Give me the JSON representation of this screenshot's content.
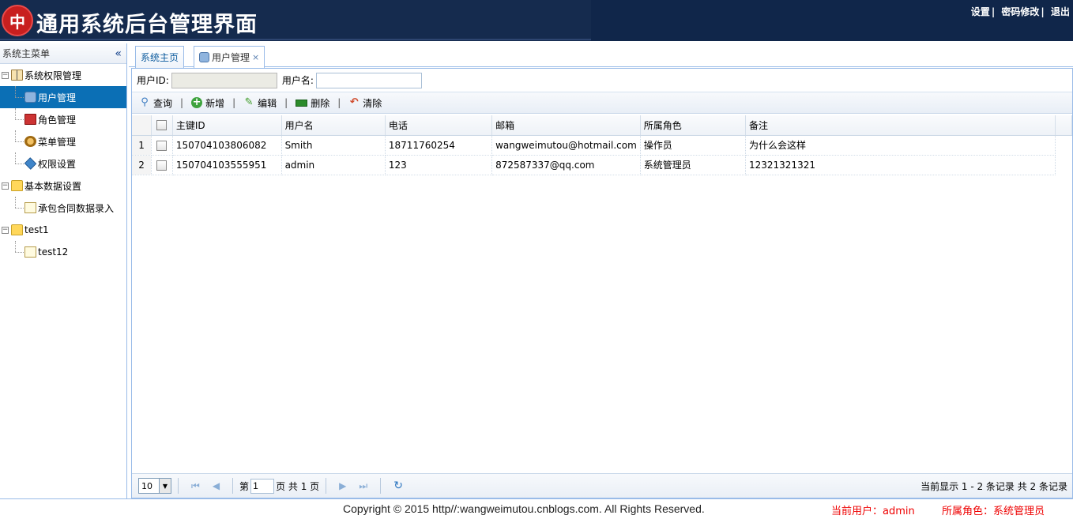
{
  "header": {
    "logo_text": "中",
    "title": "通用系统后台管理界面",
    "links": [
      "设置",
      "密码修改",
      "退出"
    ],
    "separator": "|"
  },
  "sidebar": {
    "title": "系统主菜单",
    "collapse_icon": "double-chevron-left-icon",
    "tree": [
      {
        "label": "系统权限管理",
        "level": 1,
        "icon": "book-icon",
        "expanded": true
      },
      {
        "label": "用户管理",
        "level": 2,
        "icon": "user-icon",
        "selected": true
      },
      {
        "label": "角色管理",
        "level": 2,
        "icon": "role-icon"
      },
      {
        "label": "菜单管理",
        "level": 2,
        "icon": "menu-icon"
      },
      {
        "label": "权限设置",
        "level": 2,
        "icon": "permission-icon"
      },
      {
        "label": "基本数据设置",
        "level": 1,
        "icon": "folder-icon",
        "expanded": true
      },
      {
        "label": "承包合同数据录入",
        "level": 2,
        "icon": "document-icon"
      },
      {
        "label": "test1",
        "level": 1,
        "icon": "folder-icon",
        "expanded": true
      },
      {
        "label": "test12",
        "level": 2,
        "icon": "document-icon"
      }
    ]
  },
  "tabs": [
    {
      "label": "系统主页",
      "active": false
    },
    {
      "label": "用户管理",
      "active": true,
      "close": "×"
    }
  ],
  "search": {
    "user_id_label": "用户ID:",
    "user_id_value": "",
    "username_label": "用户名:",
    "username_value": ""
  },
  "toolbar": {
    "query": "查询",
    "add": "新增",
    "edit": "编辑",
    "delete": "删除",
    "clear": "清除",
    "separator": "|"
  },
  "grid": {
    "columns": [
      "主键ID",
      "用户名",
      "电话",
      "邮箱",
      "所属角色",
      "备注"
    ],
    "rows": [
      {
        "num": "1",
        "id": "150704103806082",
        "username": "Smith",
        "phone": "18711760254",
        "email": "wangweimutou@hotmail.com",
        "role": "操作员",
        "remark": "为什么会这样"
      },
      {
        "num": "2",
        "id": "150704103555951",
        "username": "admin",
        "phone": "123",
        "email": "872587337@qq.com",
        "role": "系统管理员",
        "remark": "12321321321"
      }
    ]
  },
  "pager": {
    "page_size": "10",
    "page_prefix": "第",
    "page_value": "1",
    "page_suffix": "页 共 1 页",
    "info": "当前显示 1 - 2 条记录 共 2 条记录"
  },
  "footer": {
    "copyright": "Copyright © 2015 http//:wangweimutou.cnblogs.com. All Rights Reserved.",
    "current_user": "当前用户：admin",
    "current_role": "所属角色：系统管理员"
  }
}
